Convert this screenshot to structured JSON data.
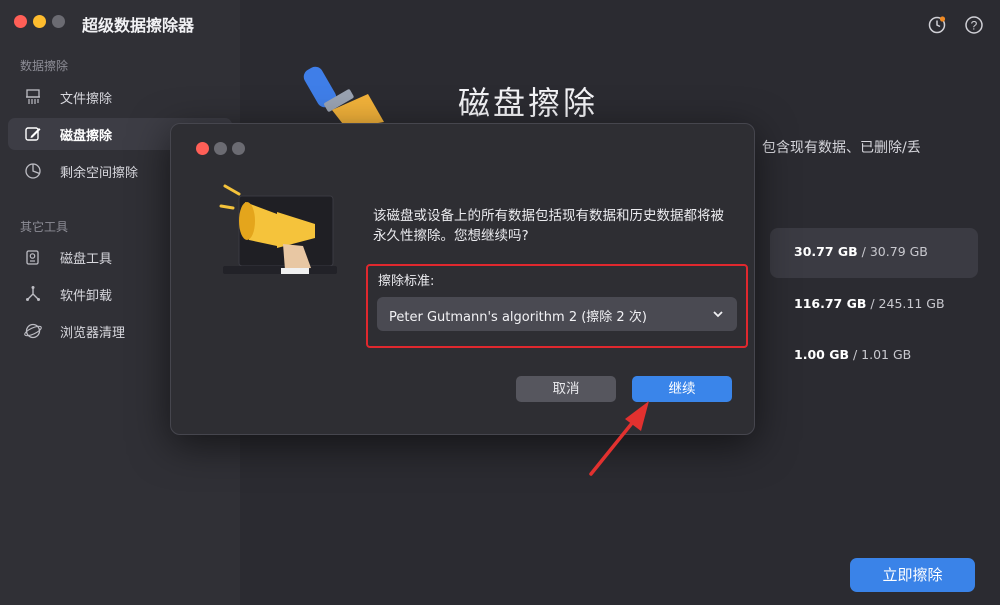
{
  "app": {
    "title": "超级数据擦除器"
  },
  "sidebar": {
    "section1": "数据擦除",
    "items1": [
      {
        "label": "文件擦除",
        "icon": "shredder-icon"
      },
      {
        "label": "磁盘擦除",
        "icon": "disk-edit-icon",
        "active": true
      },
      {
        "label": "剩余空间擦除",
        "icon": "pie-chart-icon"
      }
    ],
    "section2": "其它工具",
    "items2": [
      {
        "label": "磁盘工具",
        "icon": "disk-tool-icon"
      },
      {
        "label": "软件卸载",
        "icon": "uninstall-icon"
      },
      {
        "label": "浏览器清理",
        "icon": "browser-icon"
      }
    ]
  },
  "main": {
    "title": "磁盘擦除",
    "description_tail": "包含现有数据、已删除/丢",
    "disks": [
      {
        "used": "30.77 GB",
        "total": "/ 30.79 GB",
        "selected": true
      },
      {
        "used": "116.77 GB",
        "total": "/ 245.11 GB"
      },
      {
        "used": "1.00 GB",
        "total": "/ 1.01 GB"
      }
    ],
    "wipe_button": "立即擦除"
  },
  "dialog": {
    "message": "该磁盘或设备上的所有数据包括现有数据和历史数据都将被永久性擦除。您想继续吗?",
    "standard_label": "擦除标准:",
    "standard_value": "Peter Gutmann's algorithm 2 (擦除 2 次)",
    "cancel": "取消",
    "continue": "继续"
  },
  "colors": {
    "accent": "#3a85ea",
    "highlight": "#e0282e",
    "annotation_arrow": "#e2312f"
  }
}
